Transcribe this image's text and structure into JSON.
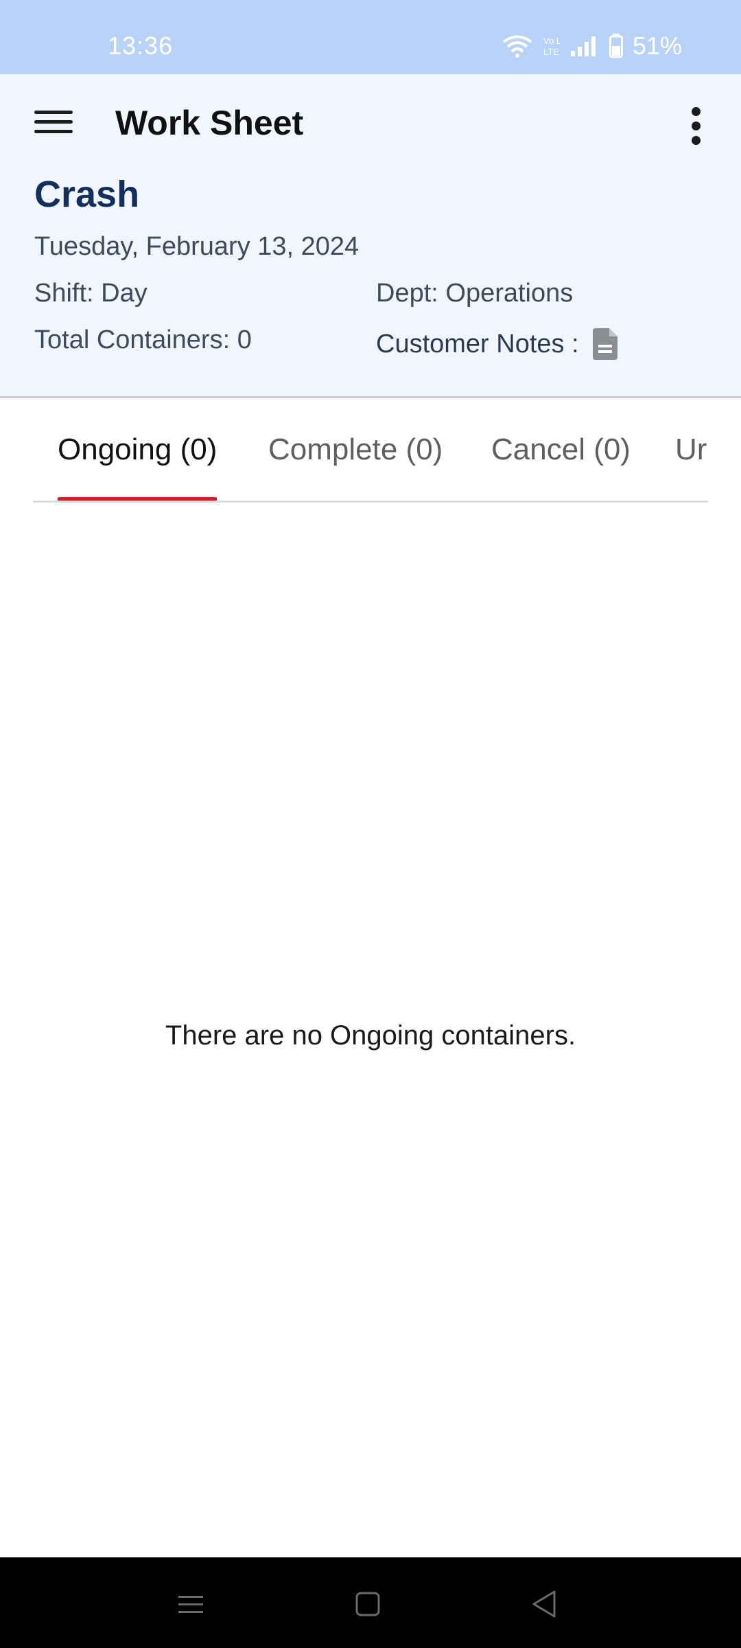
{
  "status_bar": {
    "time": "13:36",
    "network": "Vo LTE",
    "battery": "51%"
  },
  "app_bar": {
    "title": "Work Sheet",
    "menu_icon": "hamburger-menu-icon",
    "more_icon": "more-vert-icon"
  },
  "sheet": {
    "name": "Crash",
    "date": "Tuesday, February 13, 2024",
    "shift": "Shift: Day",
    "dept": "Dept: Operations",
    "total_containers": "Total Containers: 0",
    "customer_notes_label": "Customer Notes :",
    "notes_icon": "document-icon"
  },
  "tabs": [
    {
      "label": "Ongoing (0)",
      "active": true
    },
    {
      "label": "Complete (0)",
      "active": false
    },
    {
      "label": "Cancel (0)",
      "active": false
    },
    {
      "label": "Ur",
      "active": false
    }
  ],
  "empty_message": "There are no Ongoing containers.",
  "colors": {
    "status_bar": "#b9d3f8",
    "header_bg": "#f1f6fe",
    "title_navy": "#142f5a",
    "tab_indicator": "#d21f26"
  }
}
